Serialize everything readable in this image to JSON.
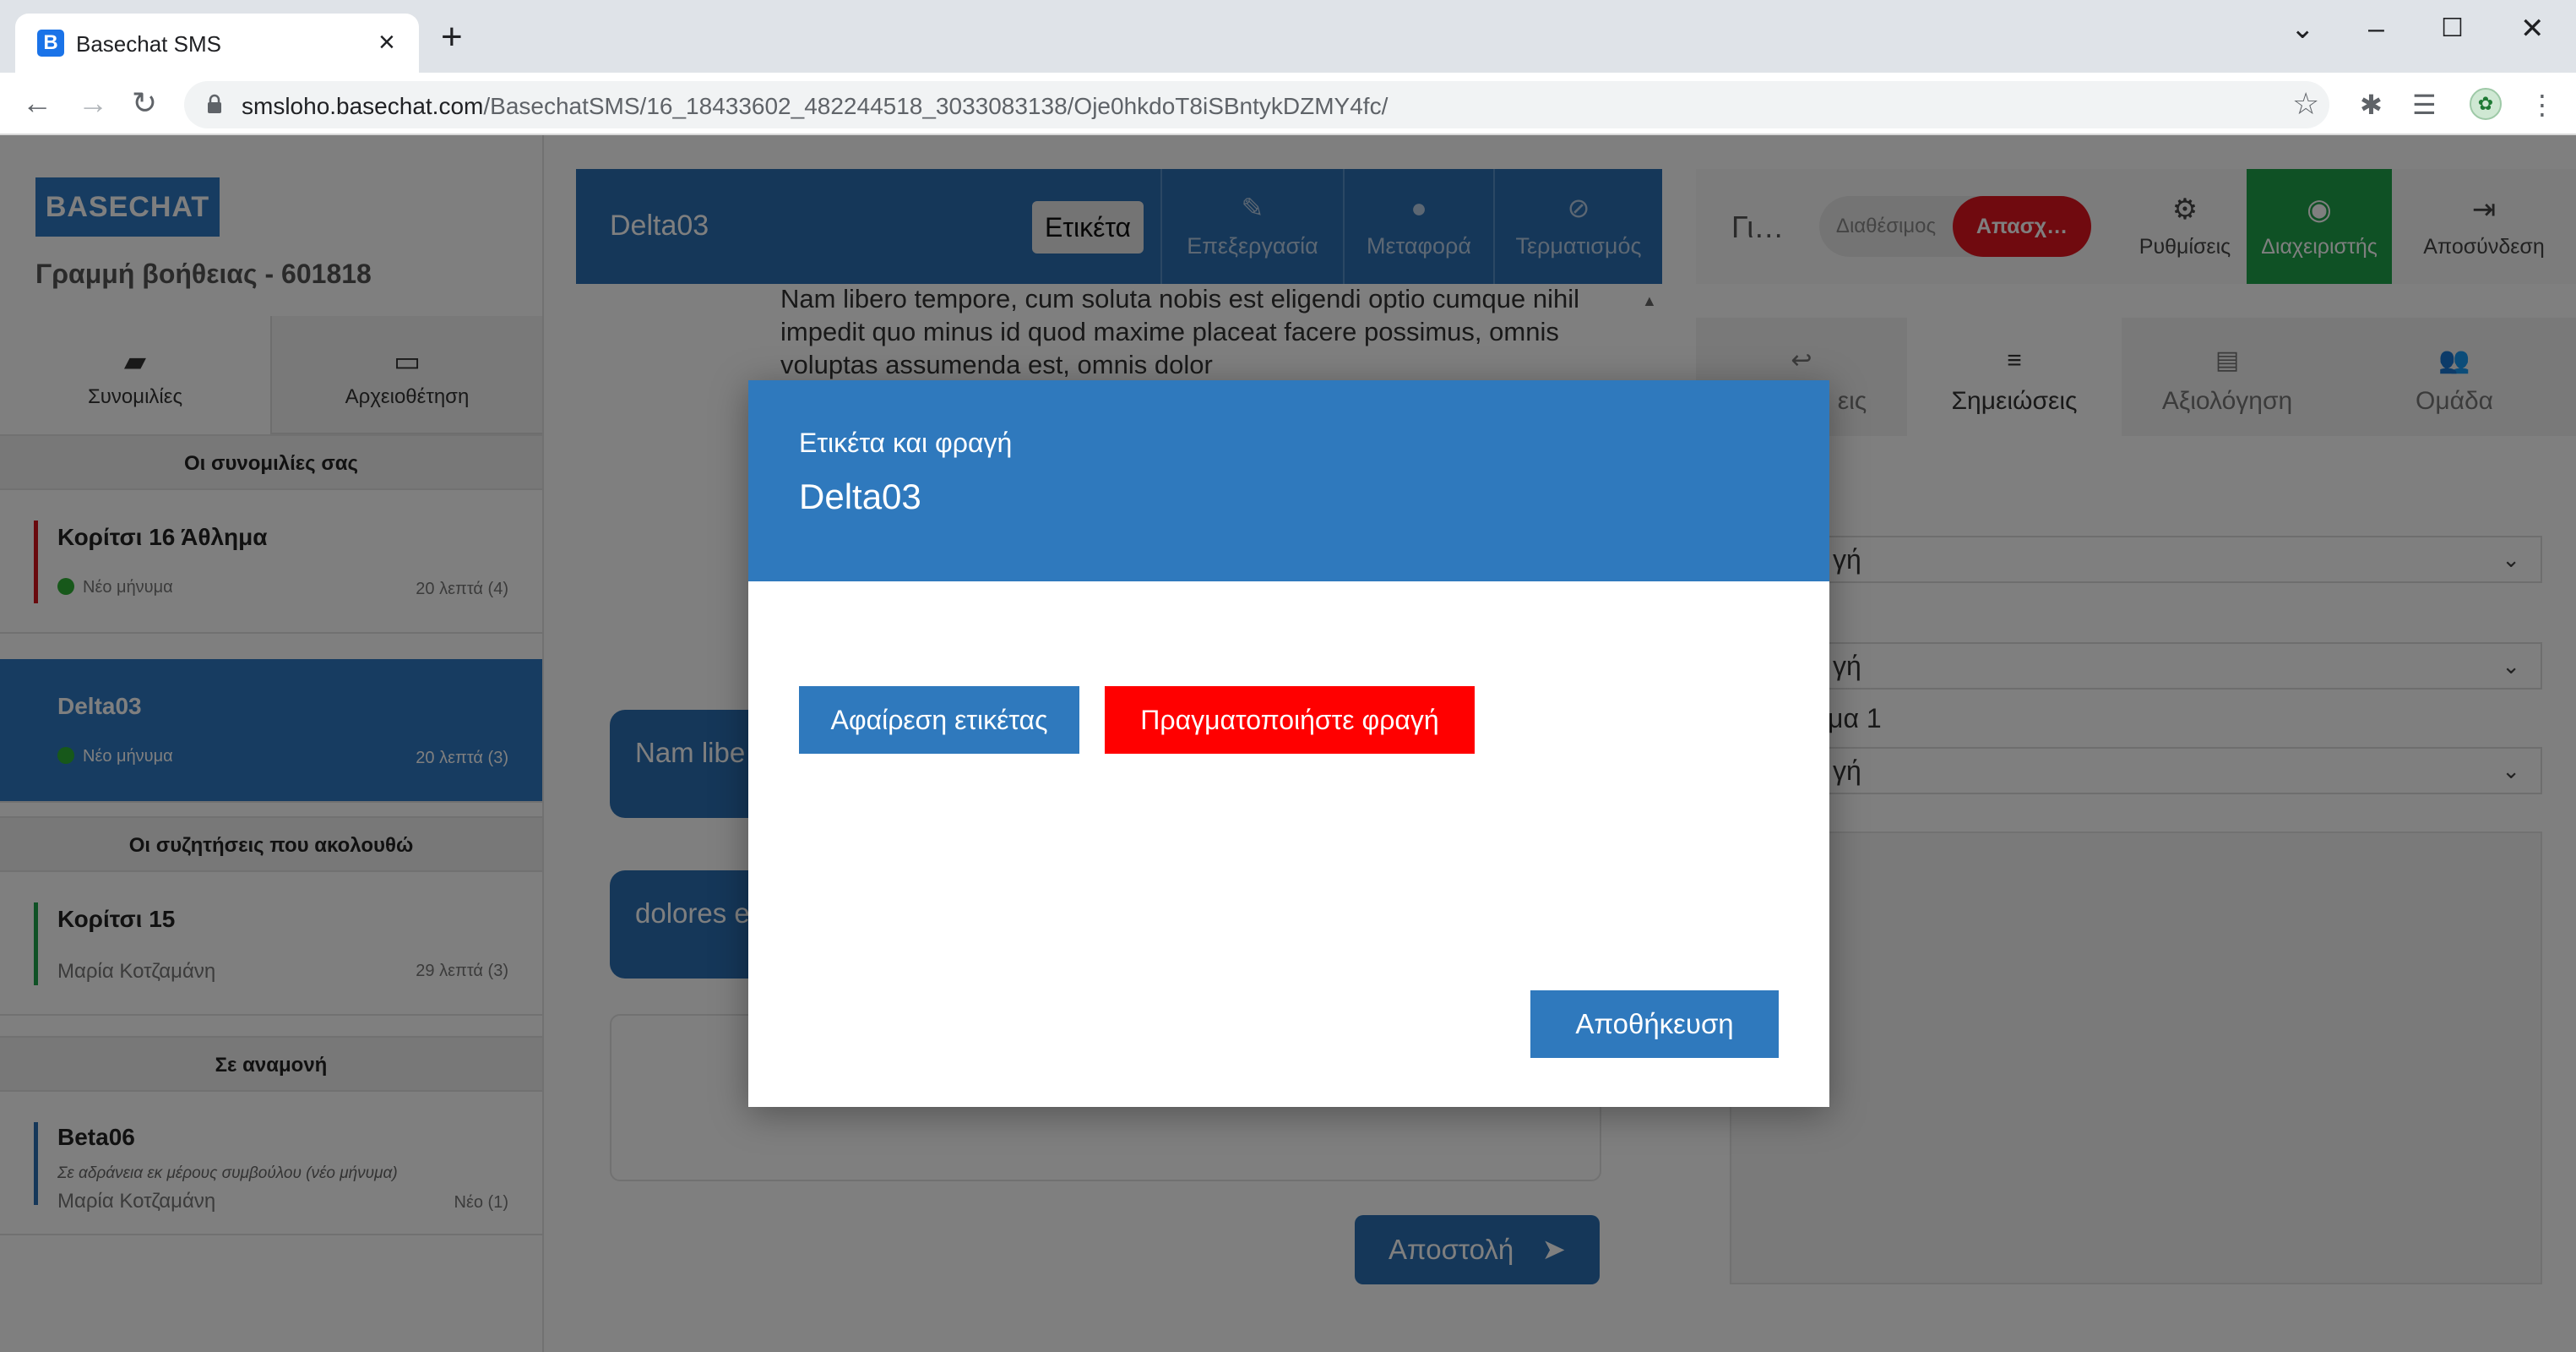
{
  "browser": {
    "tab_title": "Basechat SMS",
    "favicon_letter": "B",
    "url_host": "smsloho.basechat.com",
    "url_path": "/BasechatSMS/16_18433602_482244518_3033083138/Oje0hkdoT8iSBntykDZMY4fc/"
  },
  "sidebar": {
    "brand": "BASECHAT",
    "helpline": "Γραμμή βοήθειας - 601818",
    "tabs": {
      "conversations": "Συνομιλίες",
      "archive": "Αρχειοθέτηση"
    },
    "sections": {
      "yours": "Οι συνομιλίες σας",
      "following": "Οι συζητήσεις που ακολουθώ",
      "waiting": "Σε αναμονή"
    },
    "conversations": [
      {
        "name": "Κορίτσι 16 Άθλημα",
        "sub": "Νέο μήνυμα",
        "meta": "20 λεπτά (4)"
      },
      {
        "name": "Delta03",
        "sub": "Νέο μήνυμα",
        "meta": "20 λεπτά (3)"
      }
    ],
    "following": [
      {
        "name": "Κορίτσι 15",
        "sub": "Μαρία Κοτζαμάνη",
        "meta": "29 λεπτά (3)"
      }
    ],
    "waiting": [
      {
        "name": "Beta06",
        "note": "Σε αδράνεια εκ μέρους συμβούλου (νέο μήνυμα)",
        "sub": "Μαρία Κοτζαμάνη",
        "meta": "Νέο (1)"
      }
    ]
  },
  "chat": {
    "title": "Delta03",
    "label_button": "Ετικέτα",
    "actions": {
      "edit": "Επεξεργασία",
      "transfer": "Μεταφορά",
      "terminate": "Τερματισμός"
    },
    "message_text": "Nam libero tempore, cum soluta nobis est eligendi optio cumque nihil impedit quo minus id quod maxime placeat facere possimus, omnis voluptas assumenda est, omnis dolor",
    "bubbles": [
      "Nam libe",
      "dolores e"
    ],
    "send_label": "Αποστολή"
  },
  "right": {
    "top_label": "Γι…",
    "status_available": "Διαθέσιμος",
    "status_busy": "Απασχ…",
    "settings": "Ρυθμίσεις",
    "admin": "Διαχειριστής",
    "logout": "Αποσύνδεση",
    "tabs": {
      "replies": "εις",
      "notes": "Σημειώσεις",
      "rating": "Αξιολόγηση",
      "team": "Ομάδα"
    },
    "select1": "γή",
    "select2": "γή",
    "field_label": "γμα 1",
    "select3": "γή"
  },
  "modal": {
    "subtitle": "Ετικέτα και φραγή",
    "title": "Delta03",
    "remove_label": "Αφαίρεση ετικέτας",
    "lock": "Πραγματοποιήστε φραγή",
    "save": "Αποθήκευση"
  },
  "colors": {
    "primary": "#2f79bd",
    "header_blue": "#2b6fb3",
    "danger": "#ff0000",
    "busy": "#e0141e",
    "admin_green": "#1fa24b",
    "online_dot": "#2eb135"
  }
}
